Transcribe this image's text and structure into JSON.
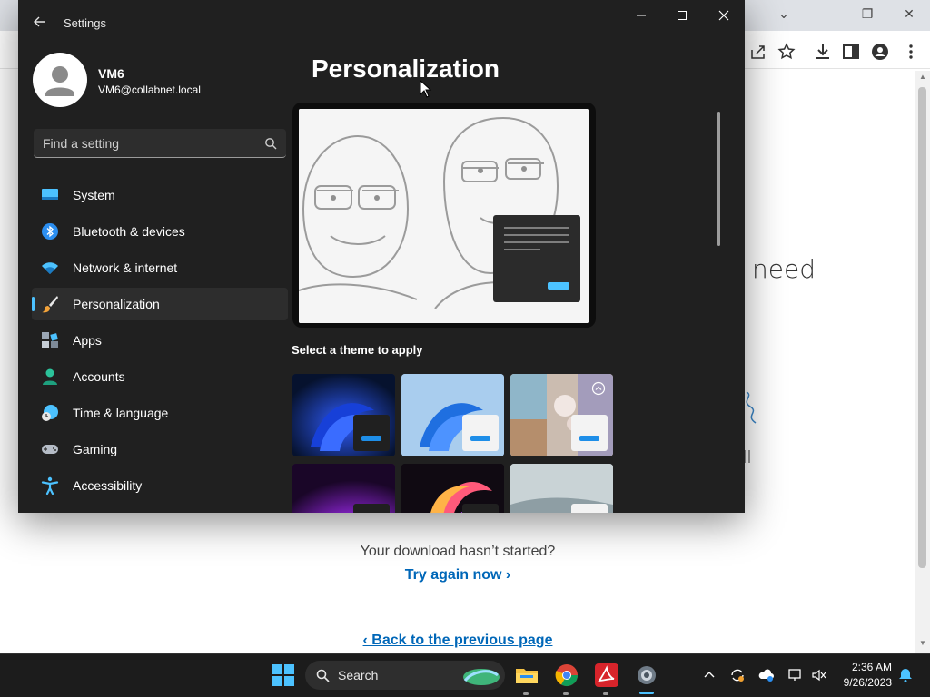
{
  "browser": {
    "page_text_fragment": "need",
    "download_message": "Your download hasn’t started?",
    "try_again_label": "Try again now ›",
    "back_link_label": "‹ Back to the previous page"
  },
  "settings": {
    "window_title": "Settings",
    "profile": {
      "name": "VM6",
      "email": "VM6@collabnet.local"
    },
    "search": {
      "placeholder": "Find a setting"
    },
    "nav": [
      {
        "label": "System",
        "icon": "monitor-icon"
      },
      {
        "label": "Bluetooth & devices",
        "icon": "bluetooth-icon"
      },
      {
        "label": "Network & internet",
        "icon": "wifi-icon"
      },
      {
        "label": "Personalization",
        "icon": "paintbrush-icon",
        "active": true
      },
      {
        "label": "Apps",
        "icon": "apps-icon"
      },
      {
        "label": "Accounts",
        "icon": "person-icon"
      },
      {
        "label": "Time & language",
        "icon": "clock-globe-icon"
      },
      {
        "label": "Gaming",
        "icon": "gamepad-icon"
      },
      {
        "label": "Accessibility",
        "icon": "accessibility-icon"
      }
    ],
    "page_title": "Personalization",
    "themes_heading": "Select a theme to apply"
  },
  "taskbar": {
    "search_label": "Search",
    "time": "2:36 AM",
    "date": "9/26/2023"
  },
  "colors": {
    "accent": "#4cc2ff",
    "link": "#0067b8",
    "settings_bg": "#202020",
    "taskbar_bg": "#1c1c1c"
  }
}
